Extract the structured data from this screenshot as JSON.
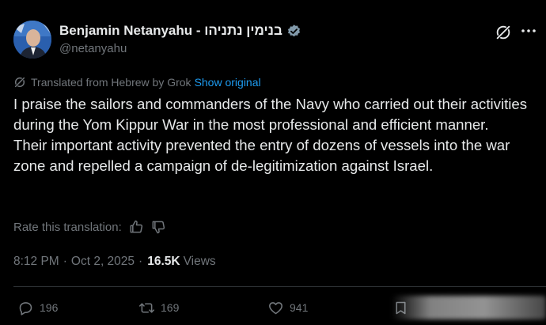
{
  "author": {
    "display_name": "Benjamin Netanyahu - בנימין נתניהו",
    "handle": "@netanyahu",
    "verified_icon": "verified-badge-icon",
    "avatar_icon": "profile-avatar"
  },
  "header_actions": {
    "grok_icon": "grok-icon",
    "more_icon": "more-dots-icon"
  },
  "translation": {
    "note": "Translated from Hebrew by Grok",
    "show_original_label": "Show original"
  },
  "tweet": {
    "paragraphs": [
      "I praise the sailors and commanders of the Navy who carried out their activities during the Yom Kippur War in the most professional and efficient manner.",
      "Their important activity prevented the entry of dozens of vessels into the war zone and repelled a campaign of de-legitimization against Israel."
    ]
  },
  "rating": {
    "label": "Rate this translation:",
    "thumbs_up_icon": "thumbs-up-icon",
    "thumbs_down_icon": "thumbs-down-icon"
  },
  "meta": {
    "time": "8:12 PM",
    "separator": "·",
    "date": "Oct 2, 2025",
    "views_count": "16.5K",
    "views_label": "Views"
  },
  "actions": {
    "replies": "196",
    "retweets": "169",
    "likes": "941"
  },
  "colors": {
    "background": "#000000",
    "text": "#e7e9ea",
    "secondary": "#71767b",
    "link": "#1d9bf0",
    "verified": "#829aab"
  }
}
